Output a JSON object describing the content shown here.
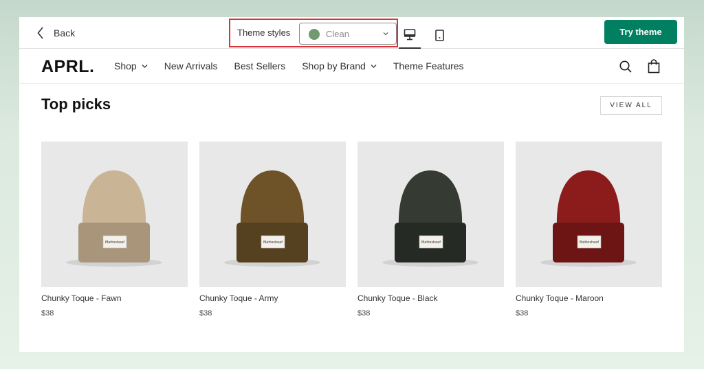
{
  "topbar": {
    "back_label": "Back",
    "theme_styles_label": "Theme styles",
    "theme_value": "Clean",
    "theme_color": "#6f9a6f",
    "try_label": "Try theme",
    "try_color": "#008060"
  },
  "store": {
    "logo": "APRL.",
    "nav": [
      {
        "label": "Shop",
        "dropdown": true
      },
      {
        "label": "New Arrivals",
        "dropdown": false
      },
      {
        "label": "Best Sellers",
        "dropdown": false
      },
      {
        "label": "Shop by Brand",
        "dropdown": true
      },
      {
        "label": "Theme Features",
        "dropdown": false
      }
    ]
  },
  "section": {
    "title": "Top picks",
    "view_all": "VIEW ALL"
  },
  "products": [
    {
      "name": "Chunky Toque - Fawn",
      "price": "$38",
      "color": "#c9b596",
      "shade": "#a9957a",
      "label": "Mattosheaf"
    },
    {
      "name": "Chunky Toque - Army",
      "price": "$38",
      "color": "#6e5228",
      "shade": "#55401f",
      "label": "Mattosheaf"
    },
    {
      "name": "Chunky Toque - Black",
      "price": "$38",
      "color": "#353a33",
      "shade": "#262a25",
      "label": "Mattosheaf"
    },
    {
      "name": "Chunky Toque - Maroon",
      "price": "$38",
      "color": "#8c1c1c",
      "shade": "#6d1414",
      "label": "Mattosheaf"
    }
  ]
}
